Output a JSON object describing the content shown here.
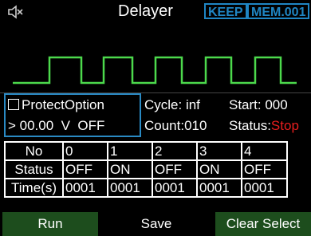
{
  "header": {
    "title": "Delayer",
    "keep_label": "KEEP",
    "mem_label": "MEM.001",
    "speaker_icon": "speaker-muted-icon"
  },
  "protect": {
    "label": "ProtectOption",
    "checked": false,
    "value_line": "> 00.00  V  OFF"
  },
  "info": {
    "cycle": "Cycle: inf",
    "start": "Start: 000",
    "count": "Count:010",
    "status_label": "Status:",
    "status_value": "Stop"
  },
  "table": {
    "headers": [
      "No",
      "0",
      "1",
      "2",
      "3",
      "4"
    ],
    "status_label": "Status",
    "statuses": [
      "OFF",
      "ON",
      "OFF",
      "ON",
      "OFF"
    ],
    "time_label": "Time(s)",
    "times": [
      "0001",
      "0001",
      "0001",
      "0001",
      "0001"
    ]
  },
  "buttons": {
    "run": "Run",
    "save": "Save",
    "clear": "Clear Select"
  },
  "colors": {
    "accent_blue": "#1f86c4",
    "wave_green": "#4cd94c",
    "stop_red": "#e81e1e",
    "button_green": "#1d4d1d"
  }
}
